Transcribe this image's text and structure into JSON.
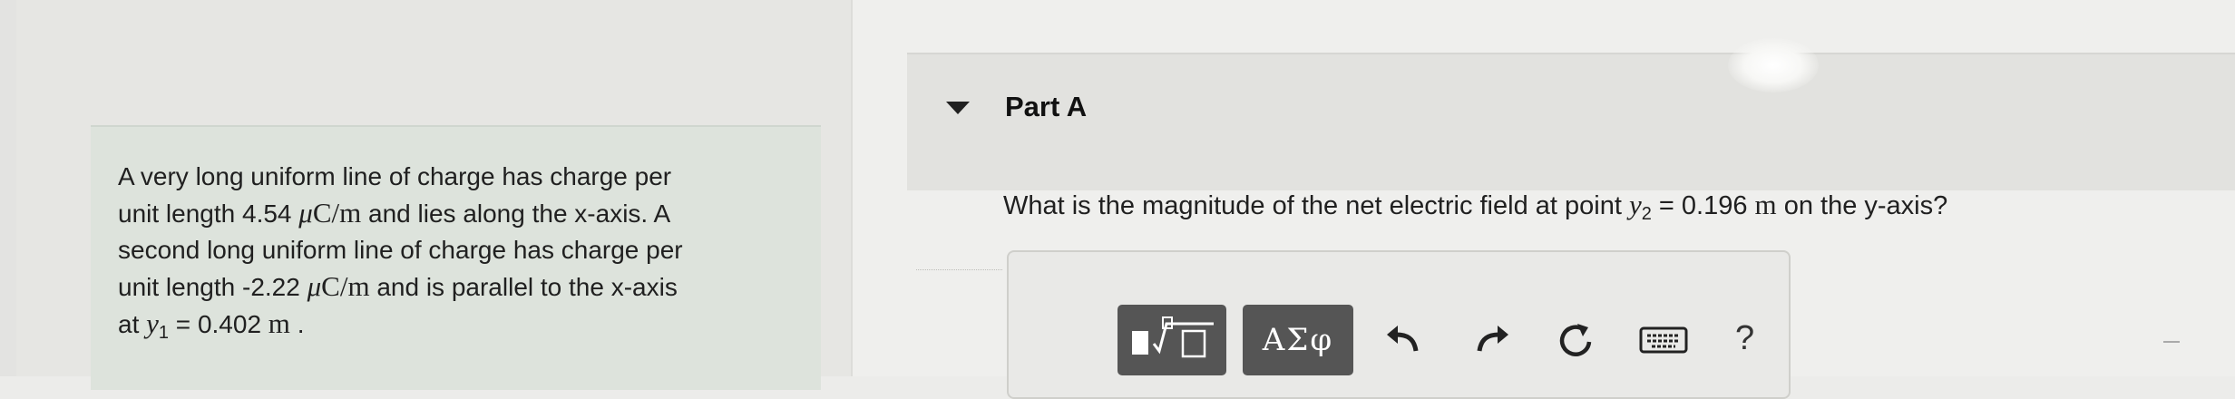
{
  "problem": {
    "line1": "A very long uniform line of charge has charge per",
    "line2_pre": "unit length 4.54 ",
    "line2_mu": "μ",
    "line2_unit": "C/m",
    "line2_post": " and lies along the x-axis. A",
    "line3": "second long uniform line of charge has charge per",
    "line4_pre": "unit length -2.22 ",
    "line4_mu": "μ",
    "line4_unit": "C/m",
    "line4_post": " and is parallel to the x-axis",
    "line5_pre": "at ",
    "line5_var": "y",
    "line5_sub": "1",
    "line5_eq": " = 0.402 ",
    "line5_unit": "m",
    "line5_post": " ."
  },
  "part": {
    "title": "Part A"
  },
  "question": {
    "pre": "What is the magnitude of the net electric field at point ",
    "var": "y",
    "sub": "2",
    "eq": " = 0.196 ",
    "unit": "m",
    "post": " on the y-axis?"
  },
  "toolbar": {
    "greek_label": "ΑΣφ",
    "help_label": "?"
  }
}
